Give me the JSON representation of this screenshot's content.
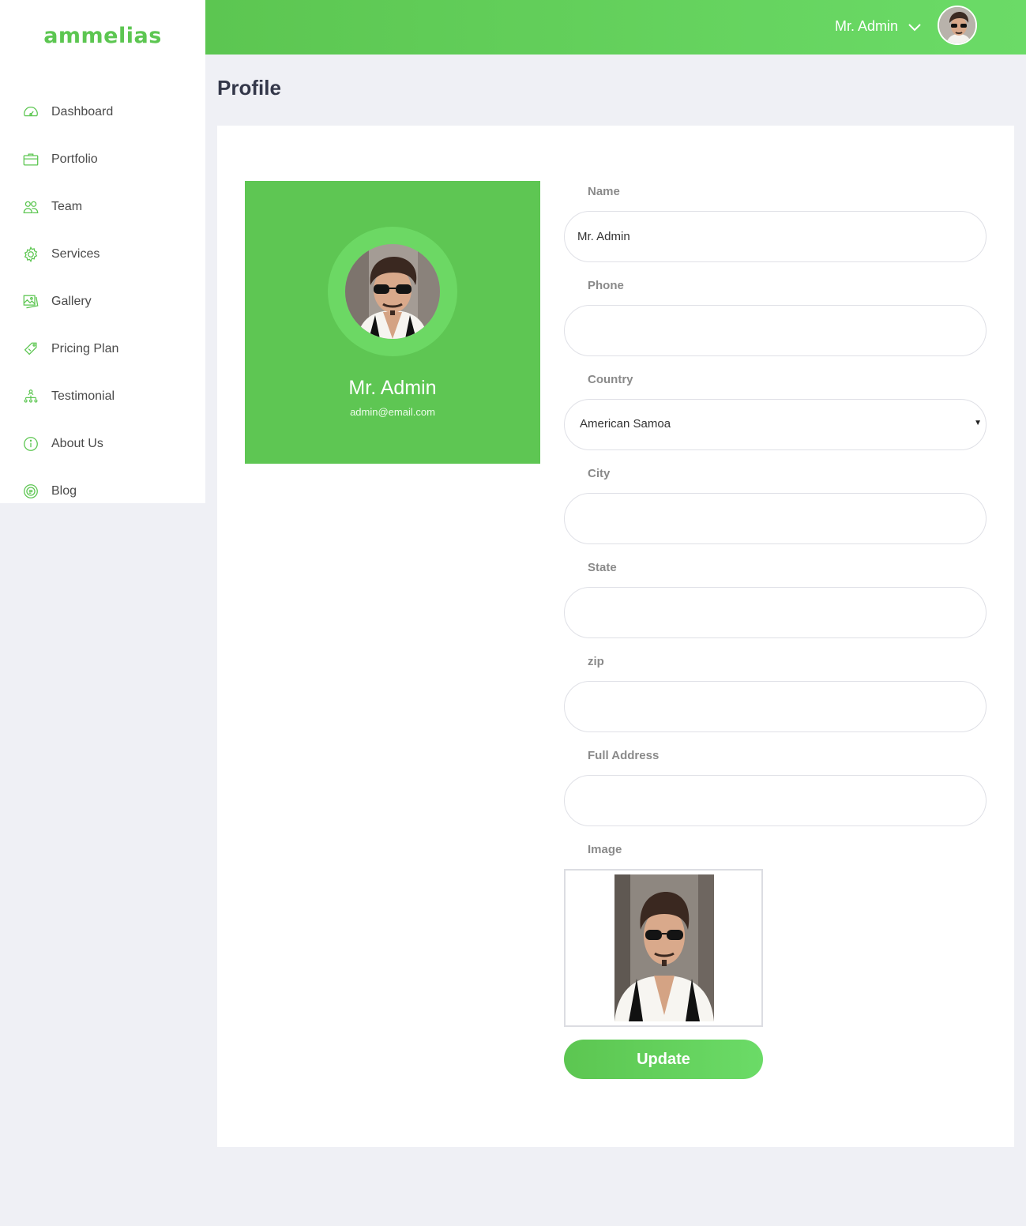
{
  "brand": {
    "logo_text": "ammelias",
    "accent_color": "#5cc651"
  },
  "sidebar": {
    "items": [
      {
        "label": "Dashboard",
        "icon": "dashboard-gauge-icon"
      },
      {
        "label": "Portfolio",
        "icon": "briefcase-icon"
      },
      {
        "label": "Team",
        "icon": "team-users-icon"
      },
      {
        "label": "Services",
        "icon": "gear-icon"
      },
      {
        "label": "Gallery",
        "icon": "gallery-images-icon"
      },
      {
        "label": "Pricing Plan",
        "icon": "price-tag-icon"
      },
      {
        "label": "Testimonial",
        "icon": "testimonial-hierarchy-icon"
      },
      {
        "label": "About Us",
        "icon": "info-circle-icon"
      },
      {
        "label": "Blog",
        "icon": "blog-circle-icon"
      }
    ]
  },
  "header": {
    "user_name": "Mr. Admin"
  },
  "page": {
    "title": "Profile"
  },
  "profile": {
    "name": "Mr. Admin",
    "email": "admin@email.com"
  },
  "form": {
    "name_label": "Name",
    "name_value": "Mr. Admin",
    "phone_label": "Phone",
    "phone_value": "",
    "country_label": "Country",
    "country_value": "American Samoa",
    "city_label": "City",
    "city_value": "",
    "state_label": "State",
    "state_value": "",
    "zip_label": "zip",
    "zip_value": "",
    "address_label": "Full Address",
    "address_value": "",
    "image_label": "Image",
    "update_label": "Update"
  }
}
